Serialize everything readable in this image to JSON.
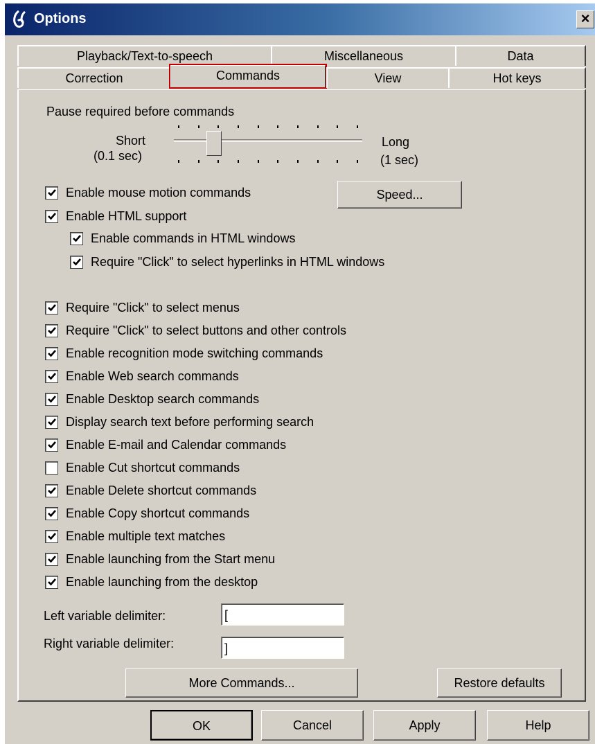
{
  "window": {
    "title": "Options",
    "close_glyph": "×"
  },
  "tabs": {
    "row1": [
      "Playback/Text-to-speech",
      "Miscellaneous",
      "Data"
    ],
    "row2": [
      "Correction",
      "Commands",
      "View",
      "Hot keys"
    ],
    "selected": "Commands"
  },
  "pause": {
    "heading": "Pause required before commands",
    "short_label": "Short",
    "short_value": "(0.1 sec)",
    "long_label": "Long",
    "long_value": "(1 sec)",
    "level_fraction": 0.2
  },
  "speed_button": "Speed...",
  "checkboxes": [
    {
      "label": "Enable mouse motion commands",
      "checked": true
    },
    {
      "label": "Enable HTML support",
      "checked": true
    },
    {
      "label": "Enable commands in HTML windows",
      "checked": true
    },
    {
      "label": "Require \"Click\" to select hyperlinks in HTML windows",
      "checked": true
    },
    {
      "label": "Require \"Click\" to select menus",
      "checked": true
    },
    {
      "label": "Require \"Click\" to select buttons and other controls",
      "checked": true
    },
    {
      "label": "Enable recognition mode switching commands",
      "checked": true
    },
    {
      "label": "Enable Web search commands",
      "checked": true
    },
    {
      "label": "Enable Desktop search commands",
      "checked": true
    },
    {
      "label": "Display search text before performing search",
      "checked": true
    },
    {
      "label": "Enable E-mail and Calendar commands",
      "checked": true
    },
    {
      "label": "Enable Cut shortcut commands",
      "checked": false
    },
    {
      "label": "Enable Delete shortcut commands",
      "checked": true
    },
    {
      "label": "Enable Copy shortcut commands",
      "checked": true
    },
    {
      "label": "Enable multiple text matches",
      "checked": true
    },
    {
      "label": "Enable launching from the Start menu",
      "checked": true
    },
    {
      "label": "Enable launching from the desktop",
      "checked": true
    }
  ],
  "delimiters": {
    "left_label": "Left variable delimiter:",
    "left_value": "[",
    "right_label": "Right variable delimiter:",
    "right_value": "]"
  },
  "panel_buttons": {
    "more_commands": "More Commands...",
    "restore_defaults": "Restore defaults"
  },
  "dialog_buttons": {
    "ok": "OK",
    "cancel": "Cancel",
    "apply": "Apply",
    "help": "Help"
  },
  "colors": {
    "face": "#d4d0c8",
    "title_start": "#0a246a",
    "title_end": "#a6caf0",
    "selected_tab_outline": "#c00000"
  }
}
